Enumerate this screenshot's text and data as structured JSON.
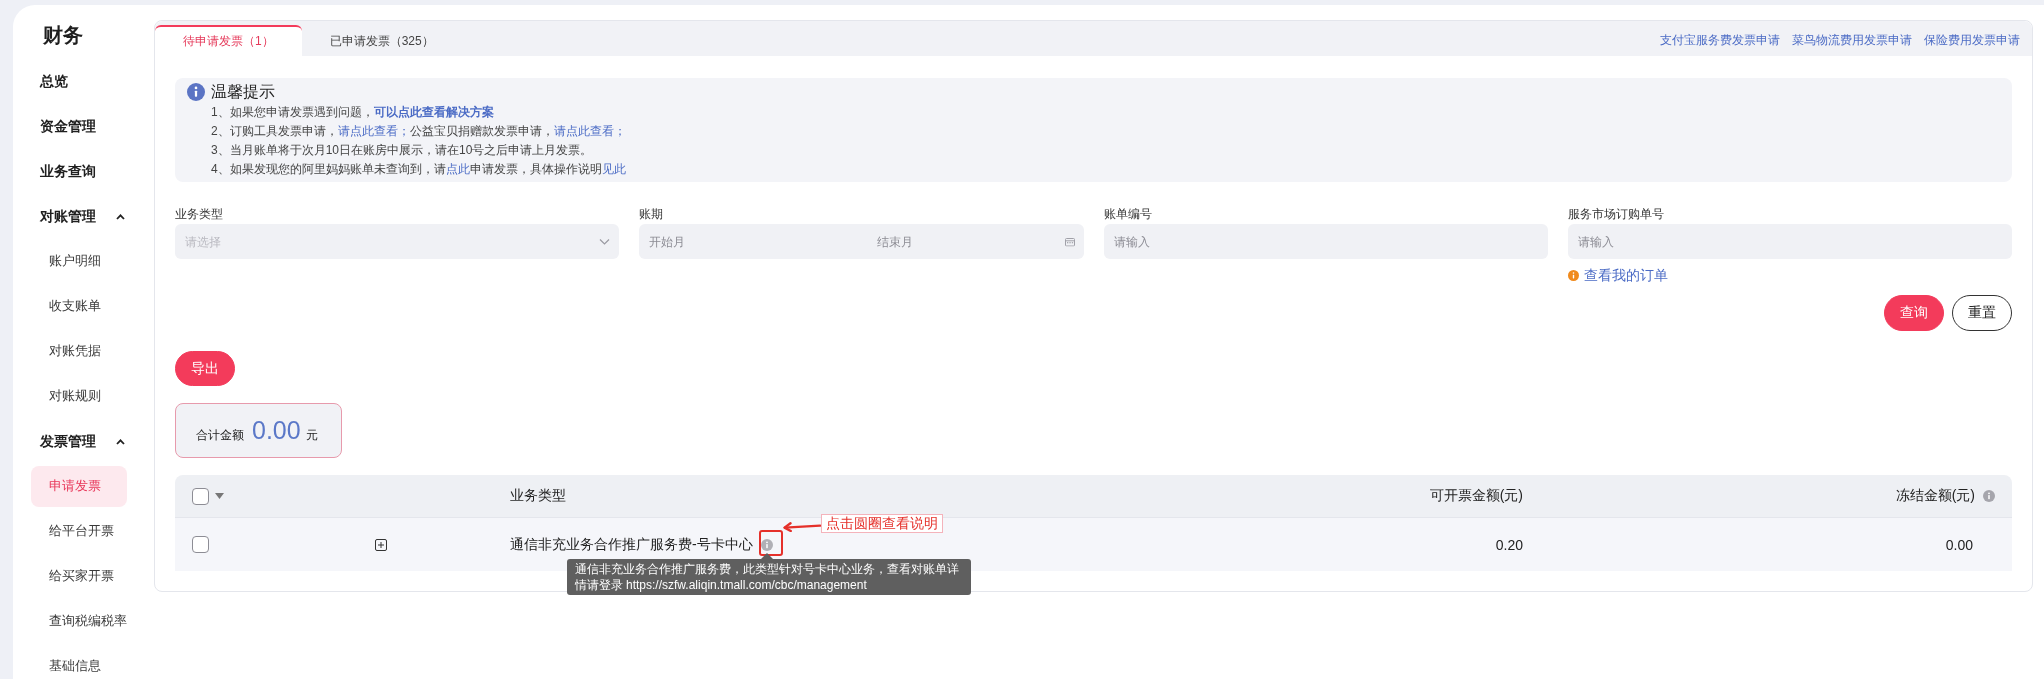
{
  "sidebar": {
    "title": "财务",
    "items": [
      {
        "label": "总览",
        "selected": false
      },
      {
        "label": "资金管理",
        "selected": false
      },
      {
        "label": "业务查询",
        "selected": false
      },
      {
        "label": "对账管理",
        "expanded": true,
        "children": [
          {
            "label": "账户明细",
            "selected": false
          },
          {
            "label": "收支账单",
            "selected": false
          },
          {
            "label": "对账凭据",
            "selected": false
          },
          {
            "label": "对账规则",
            "selected": false
          }
        ]
      },
      {
        "label": "发票管理",
        "expanded": true,
        "children": [
          {
            "label": "申请发票",
            "selected": true
          },
          {
            "label": "给平台开票",
            "selected": false
          },
          {
            "label": "给买家开票",
            "selected": false
          },
          {
            "label": "查询税编税率",
            "selected": false
          },
          {
            "label": "基础信息",
            "selected": false
          }
        ]
      }
    ]
  },
  "tabs": [
    {
      "label": "待申请发票（1）",
      "selected": true
    },
    {
      "label": "已申请发票（325）",
      "selected": false
    }
  ],
  "header_links": [
    "支付宝服务费发票申请",
    "菜鸟物流费用发票申请",
    "保险费用发票申请"
  ],
  "notice": {
    "title": "温馨提示",
    "lines": [
      [
        {
          "kind": "text",
          "text": "1、如果您申请发票遇到问题，"
        },
        {
          "kind": "link",
          "text": "可以点此查看解决方案",
          "bold": true
        }
      ],
      [
        {
          "kind": "text",
          "text": "2、订购工具发票申请，"
        },
        {
          "kind": "link",
          "text": "请点此查看；",
          "bold": false
        },
        {
          "kind": "text",
          "text": "公益宝贝捐赠款发票申请，"
        },
        {
          "kind": "link",
          "text": "请点此查看；",
          "bold": false
        }
      ],
      [
        {
          "kind": "text",
          "text": "3、当月账单将于次月10日在账房中展示，请在10号之后申请上月发票。"
        }
      ],
      [
        {
          "kind": "text",
          "text": "4、如果发现您的阿里妈妈账单未查询到，请"
        },
        {
          "kind": "link",
          "text": "点此",
          "bold": false
        },
        {
          "kind": "text",
          "text": "申请发票，具体操作说明"
        },
        {
          "kind": "link",
          "text": "见此",
          "bold": false
        }
      ]
    ]
  },
  "filters": [
    {
      "kind": "select",
      "label": "业务类型",
      "placeholder": "请选择"
    },
    {
      "kind": "range",
      "label": "账期",
      "start": {
        "placeholder": "开始月"
      },
      "end": {
        "placeholder": "结束月"
      }
    },
    {
      "kind": "input",
      "label": "账单编号",
      "placeholder": "请输入"
    },
    {
      "kind": "input",
      "label": "服务市场订购单号",
      "placeholder": "请输入",
      "hint_link": "查看我的订单"
    }
  ],
  "actions": [
    {
      "kind": "primary",
      "label": "查询"
    },
    {
      "kind": "outline",
      "label": "重置"
    }
  ],
  "export_button": {
    "label": "导出"
  },
  "total": {
    "label": "合计金额",
    "amount": "0.00",
    "unit": "元"
  },
  "table": {
    "select_all": {
      "checked": false
    },
    "columns": [
      "业务类型",
      "可开票金额(元)",
      "冻结金额(元)"
    ],
    "rows": [
      {
        "checked": false,
        "expanded": false,
        "business_type": "通信非充业务合作推广服务费-号卡中心",
        "invoiceable_amount": "0.20",
        "frozen_amount": "0.00",
        "tooltip": "通信非充业务合作推广服务费，此类型针对号卡中心业务，查看对账单详情请登录 https://szfw.aliqin.tmall.com/cbc/management"
      }
    ]
  },
  "annotation": {
    "text": "点击圆圈查看说明"
  }
}
